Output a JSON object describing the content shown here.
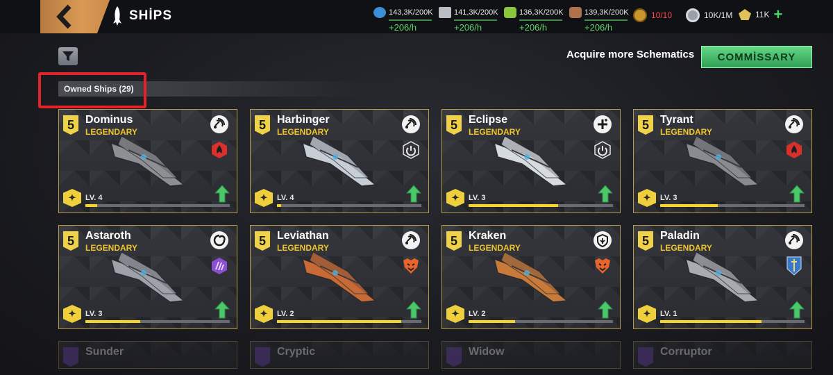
{
  "header": {
    "title": "SHİPS"
  },
  "resources": [
    {
      "icon": "blue-crystal-icon",
      "amount": "143,3K/200K",
      "rate": "+206/h",
      "color": "#3a8fd8"
    },
    {
      "icon": "metal-ingot-icon",
      "amount": "141,3K/200K",
      "rate": "+206/h",
      "color": "#b9bcc2"
    },
    {
      "icon": "green-ore-icon",
      "amount": "136,3K/200K",
      "rate": "+206/h",
      "color": "#8cc63f"
    },
    {
      "icon": "brown-ore-icon",
      "amount": "139,3K/200K",
      "rate": "+206/h",
      "color": "#b0724b"
    }
  ],
  "simple_resources": {
    "medals": "10/10",
    "credits": "10K/1M",
    "gems": "11K"
  },
  "acquire_text": "Acquire more Schematics",
  "commissary_label": "COMMİSSARY",
  "owned_label": "Owned Ships (29)",
  "ships": [
    {
      "name": "Dominus",
      "rarity": "LEGENDARY",
      "tier": "5",
      "level": "LV. 4",
      "progress": 0.08,
      "class_icon": "antenna-icon",
      "faction_icon": "red-flame-emblem-icon",
      "faction_color": "#d8312b"
    },
    {
      "name": "Harbinger",
      "rarity": "LEGENDARY",
      "tier": "5",
      "level": "LV. 4",
      "progress": 0.03,
      "class_icon": "antenna-icon",
      "faction_icon": "white-power-emblem-icon",
      "faction_color": "#e8e8e8"
    },
    {
      "name": "Eclipse",
      "rarity": "LEGENDARY",
      "tier": "5",
      "level": "LV. 3",
      "progress": 0.62,
      "class_icon": "medic-cross-icon",
      "faction_icon": "white-power-emblem-icon",
      "faction_color": "#e8e8e8"
    },
    {
      "name": "Tyrant",
      "rarity": "LEGENDARY",
      "tier": "5",
      "level": "LV. 3",
      "progress": 0.4,
      "class_icon": "antenna-icon",
      "faction_icon": "red-flame-emblem-icon",
      "faction_color": "#d8312b"
    },
    {
      "name": "Astaroth",
      "rarity": "LEGENDARY",
      "tier": "5",
      "level": "LV. 3",
      "progress": 0.38,
      "class_icon": "spiral-icon",
      "faction_icon": "purple-claw-emblem-icon",
      "faction_color": "#8b4fd0"
    },
    {
      "name": "Leviathan",
      "rarity": "LEGENDARY",
      "tier": "5",
      "level": "LV. 2",
      "progress": 0.86,
      "class_icon": "antenna-icon",
      "faction_icon": "orange-beast-emblem-icon",
      "faction_color": "#e8642a"
    },
    {
      "name": "Kraken",
      "rarity": "LEGENDARY",
      "tier": "5",
      "level": "LV. 2",
      "progress": 0.32,
      "class_icon": "shield-leaf-icon",
      "faction_icon": "orange-beast-emblem-icon",
      "faction_color": "#e8642a"
    },
    {
      "name": "Paladin",
      "rarity": "LEGENDARY",
      "tier": "5",
      "level": "LV. 1",
      "progress": 0.7,
      "class_icon": "antenna-icon",
      "faction_icon": "blue-sword-emblem-icon",
      "faction_color": "#3a78c8"
    }
  ],
  "partial_ships": [
    "Sunder",
    "Cryptic",
    "Widow",
    "Corruptor"
  ]
}
